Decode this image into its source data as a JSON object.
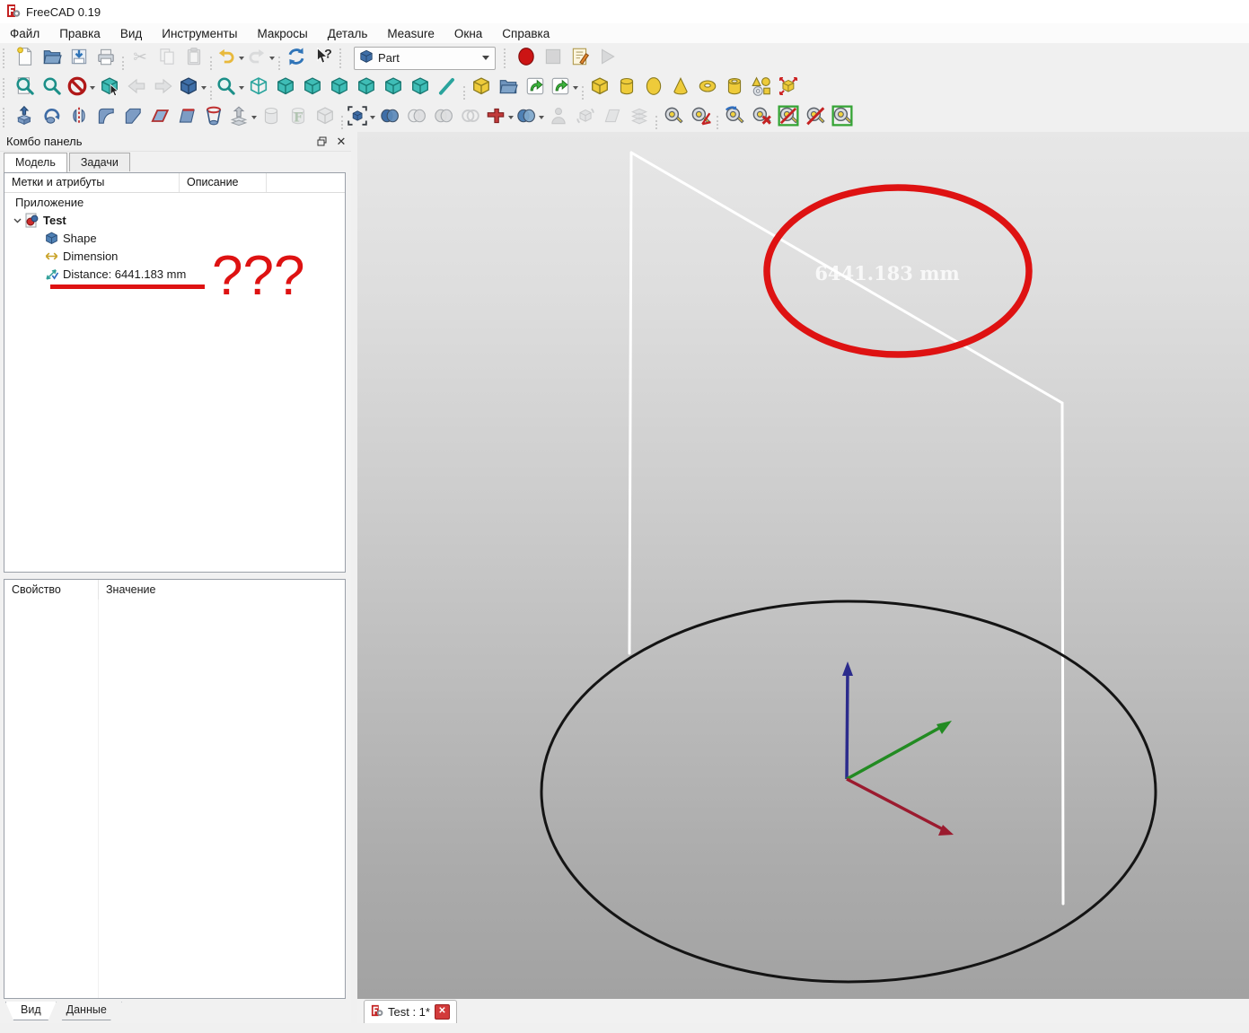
{
  "window": {
    "title": "FreeCAD 0.19"
  },
  "menu": {
    "items": [
      {
        "id": "file",
        "label": "Файл"
      },
      {
        "id": "edit",
        "label": "Правка"
      },
      {
        "id": "view",
        "label": "Вид"
      },
      {
        "id": "tools",
        "label": "Инструменты"
      },
      {
        "id": "macros",
        "label": "Макросы"
      },
      {
        "id": "part",
        "label": "Деталь"
      },
      {
        "id": "measure",
        "label": "Measure"
      },
      {
        "id": "windows",
        "label": "Окна"
      },
      {
        "id": "help",
        "label": "Справка"
      }
    ]
  },
  "workbench": {
    "selected": "Part",
    "icon": "part-cube-icon"
  },
  "toolbars": {
    "row1": [
      {
        "n": "new-file-button",
        "s": "page",
        "c": "#f3d23c"
      },
      {
        "n": "open-file-button",
        "s": "folder",
        "c": "#5b89ba"
      },
      {
        "n": "save-button",
        "s": "save"
      },
      {
        "n": "print-button",
        "s": "print"
      },
      {
        "sep": true
      },
      {
        "n": "cut-button",
        "s": "scissors",
        "x": 1
      },
      {
        "n": "copy-button",
        "s": "copy",
        "x": 1
      },
      {
        "n": "paste-button",
        "s": "clipboard",
        "x": 1
      },
      {
        "sep": true
      },
      {
        "n": "undo-button",
        "s": "undo",
        "c": "#e8b93c",
        "d": 1
      },
      {
        "n": "redo-button",
        "s": "redo",
        "c": "#b9bdc4",
        "x": 1,
        "d": 1
      },
      {
        "sep": true
      },
      {
        "n": "refresh-button",
        "s": "sync"
      },
      {
        "n": "whats-this-button",
        "s": "helpcursor"
      }
    ],
    "macro": [
      {
        "n": "macro-record-button",
        "s": "circleicon",
        "c": "#cc1414"
      },
      {
        "n": "macro-stop-button",
        "s": "squareicon",
        "x": 1
      },
      {
        "n": "macro-edit-button",
        "s": "macroedit"
      },
      {
        "n": "macro-play-button",
        "s": "playicon",
        "x": 1
      }
    ],
    "row2": [
      {
        "n": "fit-all-button",
        "s": "magpage",
        "c": "#1b8f88"
      },
      {
        "n": "fit-selection-button",
        "s": "magnifier",
        "c": "#1b8f88"
      },
      {
        "n": "navigation-style-button",
        "s": "nosign",
        "d": 1
      },
      {
        "n": "box-selection-button",
        "s": "cubecursor",
        "c": "#3fbdb6",
        "c2": "#16756f"
      },
      {
        "n": "nav-back-button",
        "s": "arrowL",
        "x": 1
      },
      {
        "n": "nav-forward-button",
        "s": "arrowR",
        "x": 1
      },
      {
        "n": "home-view-button",
        "s": "cube",
        "c": "#3f6fa8",
        "c2": "#223f63",
        "d": 1
      },
      {
        "sep": true
      },
      {
        "n": "zoom-button",
        "s": "magnifier",
        "c": "#1b8f88",
        "d": 1
      },
      {
        "n": "view-axonometric-button",
        "s": "cubewire",
        "c": "#2aa49d"
      },
      {
        "n": "view-front-button",
        "s": "cube",
        "c": "#3fbdb6",
        "c2": "#16756f"
      },
      {
        "n": "view-top-button",
        "s": "cube",
        "c": "#3fbdb6",
        "c2": "#16756f"
      },
      {
        "n": "view-right-button",
        "s": "cube",
        "c": "#3fbdb6",
        "c2": "#16756f"
      },
      {
        "n": "view-rear-button",
        "s": "cube",
        "c": "#3fbdb6",
        "c2": "#16756f"
      },
      {
        "n": "view-bottom-button",
        "s": "cube",
        "c": "#3fbdb6",
        "c2": "#16756f"
      },
      {
        "n": "view-left-button",
        "s": "cube",
        "c": "#3fbdb6",
        "c2": "#16756f"
      },
      {
        "n": "pen-line-button",
        "s": "pen",
        "c": "#2aa49d"
      },
      {
        "sep": true
      },
      {
        "n": "create-part-button",
        "s": "cube",
        "c": "#eecb3a",
        "c2": "#8a7a1e"
      },
      {
        "n": "create-group-button",
        "s": "folder",
        "c": "#6f94bd"
      },
      {
        "n": "make-link-button",
        "s": "link"
      },
      {
        "n": "make-sub-link-button",
        "s": "link",
        "d": 1
      },
      {
        "sep": true
      },
      {
        "n": "primitive-box-button",
        "s": "cube",
        "c": "#eecb3a",
        "c2": "#8a7a1e"
      },
      {
        "n": "primitive-cylinder-button",
        "s": "cylinder",
        "c": "#eecb3a",
        "c2": "#8a7a1e"
      },
      {
        "n": "primitive-sphere-button",
        "s": "sphere",
        "c": "#eecb3a",
        "c2": "#8a7a1e"
      },
      {
        "n": "primitive-cone-button",
        "s": "cone",
        "c": "#eecb3a",
        "c2": "#8a7a1e"
      },
      {
        "n": "primitive-torus-button",
        "s": "torus",
        "c": "#eecb3a",
        "c2": "#8a7a1e"
      },
      {
        "n": "primitive-tube-button",
        "s": "tube",
        "c": "#eecb3a",
        "c2": "#8a7a1e"
      },
      {
        "n": "create-primitives-button",
        "s": "primmulti"
      },
      {
        "n": "shape-builder-button",
        "s": "builder"
      }
    ],
    "row3": [
      {
        "n": "extrude-button",
        "s": "extrude"
      },
      {
        "n": "revolve-button",
        "s": "revolve"
      },
      {
        "n": "mirror-button",
        "s": "mirrorI"
      },
      {
        "n": "fillet-button",
        "s": "fillet"
      },
      {
        "n": "chamfer-button",
        "s": "chamfer"
      },
      {
        "n": "make-face-button",
        "s": "facepln"
      },
      {
        "n": "ruled-surface-button",
        "s": "ruled"
      },
      {
        "n": "loft-button",
        "s": "loft"
      },
      {
        "n": "sweep-button",
        "s": "sweep",
        "d": 1
      },
      {
        "n": "cross-sections-button",
        "s": "section",
        "x": 1
      },
      {
        "n": "offset-button",
        "s": "offsetF",
        "x": 1
      },
      {
        "n": "thickness-button",
        "s": "cube",
        "c": "#d5d9de",
        "c2": "#8a9099",
        "x": 1
      },
      {
        "sep": true
      },
      {
        "n": "compound-tools-button",
        "s": "bracketcube",
        "d": 1
      },
      {
        "n": "boolean-button",
        "s": "spheres2",
        "c": "#3f6fa8",
        "c2": "#5b89ba"
      },
      {
        "n": "cut-boolean-button",
        "s": "spheres2",
        "c": "#dfe3e8",
        "c2": "#c3c8cf",
        "x": 1
      },
      {
        "n": "union-button",
        "s": "spheres2",
        "c": "#c3c8cf",
        "c2": "#c3c8cf",
        "x": 1
      },
      {
        "n": "intersection-button",
        "s": "circles2",
        "x": 1
      },
      {
        "n": "connect-button",
        "s": "tshape",
        "d": 1
      },
      {
        "n": "split-button",
        "s": "spheres2",
        "c": "#4f81b5",
        "c2": "#7fa8cc",
        "d": 1
      },
      {
        "n": "check-geometry-button",
        "s": "person",
        "x": 1
      },
      {
        "n": "defeaturing-button",
        "s": "defeature",
        "x": 1
      },
      {
        "n": "convert-shape-button",
        "s": "sheet",
        "x": 1
      },
      {
        "n": "slice-stack-button",
        "s": "stack",
        "x": 1
      },
      {
        "sep": true
      },
      {
        "n": "measure-linear-button",
        "s": "tape"
      },
      {
        "n": "measure-angular-button",
        "s": "tape",
        "ov": "angle"
      },
      {
        "sep": true
      },
      {
        "n": "measure-refresh-button",
        "s": "tape",
        "ov": "arrows"
      },
      {
        "n": "measure-clear-all-button",
        "s": "tape",
        "ov": "x"
      },
      {
        "n": "toggle-measurement-3d-button",
        "s": "tape",
        "ov": "frameslash"
      },
      {
        "n": "toggle-measurement-delta-button",
        "s": "tape",
        "ov": "slash"
      },
      {
        "n": "toggle-measurement-all-button",
        "s": "tape",
        "ov": "frame"
      }
    ]
  },
  "combo_panel": {
    "title": "Комбо панель",
    "tabs": [
      {
        "id": "model",
        "label": "Модель",
        "active": true
      },
      {
        "id": "tasks",
        "label": "Задачи",
        "active": false
      }
    ],
    "tree": {
      "columns": [
        "Метки и атрибуты",
        "Описание"
      ],
      "root_label": "Приложение",
      "items": [
        {
          "id": "test",
          "label": "Test",
          "icon": "document-icon",
          "bold": true,
          "expander": true,
          "level": 1
        },
        {
          "id": "shape",
          "label": "Shape",
          "icon": "shape-cube-icon",
          "level": 2
        },
        {
          "id": "dimension",
          "label": "Dimension",
          "icon": "dimension-arrows-icon",
          "level": 2
        },
        {
          "id": "distance",
          "label": "Distance: 6441.183 mm",
          "icon": "measurement-icon",
          "level": 2
        }
      ]
    },
    "properties": {
      "columns": [
        "Свойство",
        "Значение"
      ]
    },
    "bottom_tabs": [
      {
        "id": "view",
        "label": "Вид",
        "active": true
      },
      {
        "id": "data",
        "label": "Данные",
        "active": false
      }
    ]
  },
  "viewport": {
    "dimension_label": "6441.183 mm",
    "mdi_tab": {
      "label": "Test : 1*",
      "close_label": "✕"
    },
    "axis_colors": {
      "x": "#9b1b2f",
      "y": "#228b22",
      "z": "#2b2b8c"
    },
    "edge_color": "#ffffff",
    "circle_color": "#141414"
  },
  "annotations": {
    "question_marks": "???",
    "color": "#de1212"
  },
  "colors": {
    "accent_red": "#de1212",
    "teal": "#3fbdb6",
    "primitive_yellow": "#eecb3a",
    "steel_blue": "#3f6fa8"
  }
}
